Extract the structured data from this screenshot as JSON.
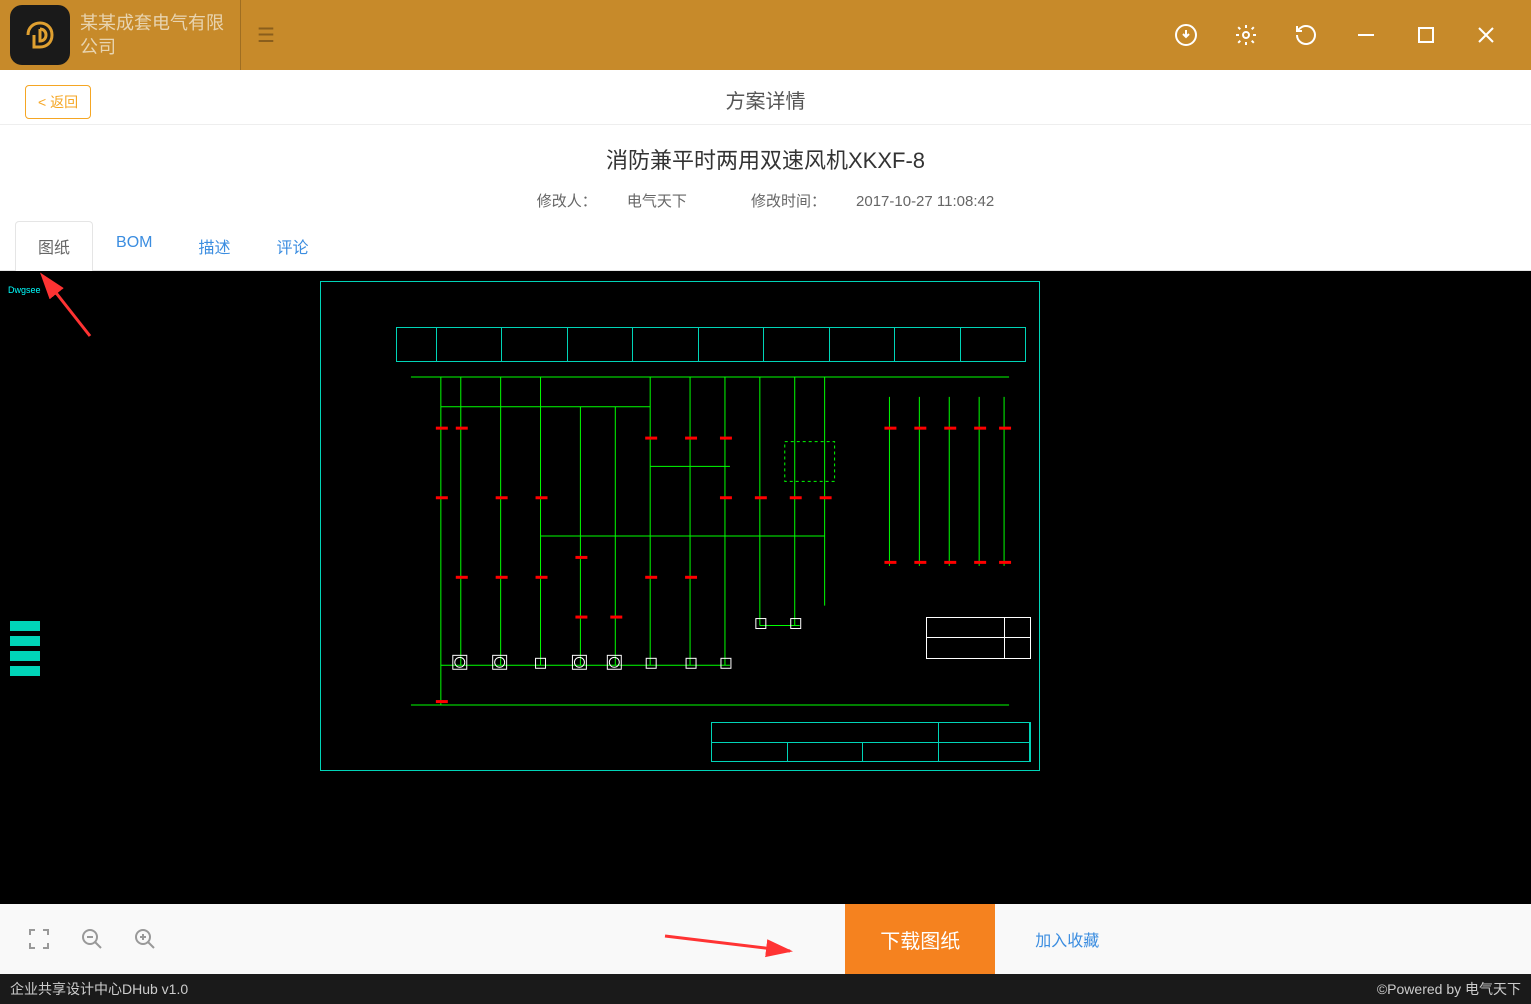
{
  "titlebar": {
    "company_name": "某某成套电气有限公司"
  },
  "header": {
    "back_label": "< 返回",
    "page_title": "方案详情"
  },
  "detail": {
    "title": "消防兼平时两用双速风机XKXF-8",
    "modifier_label": "修改人：",
    "modifier_value": "电气天下",
    "modtime_label": "修改时间：",
    "modtime_value": "2017-10-27 11:08:42"
  },
  "tabs": {
    "drawing": "图纸",
    "bom": "BOM",
    "desc": "描述",
    "comment": "评论"
  },
  "drawing": {
    "top_label": "Dwgsee"
  },
  "toolbar": {
    "download_label": "下载图纸",
    "favorite_label": "加入收藏"
  },
  "statusbar": {
    "left": "企业共享设计中心DHub v1.0",
    "right": "©Powered by 电气天下"
  }
}
